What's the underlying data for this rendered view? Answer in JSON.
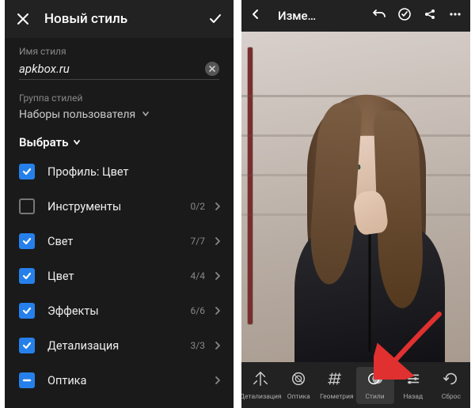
{
  "left": {
    "header": {
      "title": "Новый стиль"
    },
    "nameField": {
      "label": "Имя стиля",
      "value": "apkbox.ru"
    },
    "groupField": {
      "label": "Группа стилей",
      "value": "Наборы пользователя"
    },
    "selectLabel": "Выбрать",
    "options": [
      {
        "label": "Профиль: Цвет",
        "state": "checked",
        "count": ""
      },
      {
        "label": "Инструменты",
        "state": "unchecked",
        "count": "0/2"
      },
      {
        "label": "Свет",
        "state": "checked",
        "count": "7/7"
      },
      {
        "label": "Цвет",
        "state": "checked",
        "count": "4/4"
      },
      {
        "label": "Эффекты",
        "state": "checked",
        "count": "6/6"
      },
      {
        "label": "Детализация",
        "state": "checked",
        "count": "3/3"
      },
      {
        "label": "Оптика",
        "state": "partial",
        "count": ""
      }
    ]
  },
  "right": {
    "header": {
      "title": "Изме…"
    },
    "tools": [
      {
        "label": "Детализация"
      },
      {
        "label": "Оптика"
      },
      {
        "label": "Геометрия"
      },
      {
        "label": "Стили"
      },
      {
        "label": "Назад"
      },
      {
        "label": "Сброс"
      }
    ]
  }
}
